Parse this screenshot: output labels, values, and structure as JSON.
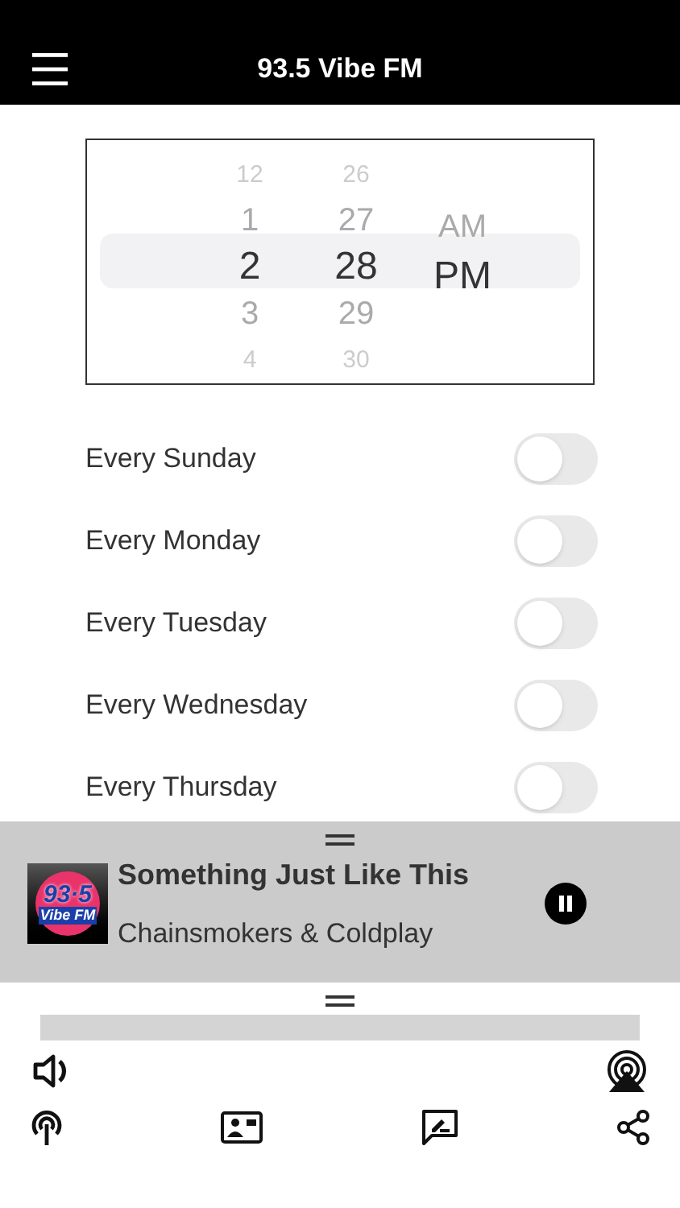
{
  "header": {
    "title": "93.5 Vibe FM"
  },
  "picker": {
    "columns": [
      {
        "items": [
          {
            "text": "12",
            "selected": false
          },
          {
            "text": "1",
            "selected": false
          },
          {
            "text": "2",
            "selected": true
          },
          {
            "text": "3",
            "selected": false
          },
          {
            "text": "4",
            "selected": false
          }
        ]
      },
      {
        "items": [
          {
            "text": "26",
            "selected": false
          },
          {
            "text": "27",
            "selected": false
          },
          {
            "text": "28",
            "selected": true
          },
          {
            "text": "29",
            "selected": false
          },
          {
            "text": "30",
            "selected": false
          }
        ]
      },
      {
        "items": [
          {
            "text": "AM",
            "selected": false
          },
          {
            "text": "PM",
            "selected": true
          }
        ]
      }
    ]
  },
  "repeat_days": [
    {
      "label": "Every Sunday",
      "on": false
    },
    {
      "label": "Every Monday",
      "on": false
    },
    {
      "label": "Every Tuesday",
      "on": false
    },
    {
      "label": "Every Wednesday",
      "on": false
    },
    {
      "label": "Every Thursday",
      "on": false
    }
  ],
  "now_playing": {
    "logo": {
      "number": "93·5",
      "name": "Vibe FM"
    },
    "title": "Something Just Like This",
    "artist": "Chainsmokers & Coldplay",
    "playing": true
  }
}
